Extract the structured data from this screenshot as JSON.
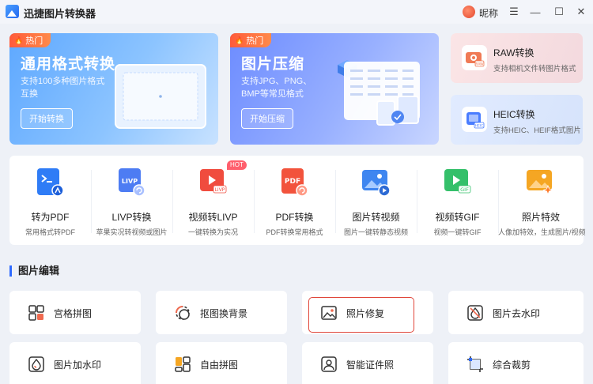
{
  "app": {
    "title": "迅捷图片转换器",
    "nickname": "昵称"
  },
  "window_controls": {
    "menu": "☰",
    "minimize": "—",
    "maximize": "☐",
    "close": "✕"
  },
  "hero_cards": [
    {
      "tag": "热门",
      "title": "通用格式转换",
      "desc": "支持100多种图片格式互换",
      "button": "开始转换",
      "accent": "#5ea8ff"
    },
    {
      "tag": "热门",
      "title": "图片压缩",
      "desc": "支持JPG、PNG、BMP等常见格式",
      "button": "开始压缩",
      "accent": "#6d8cff"
    }
  ],
  "side_cards": [
    {
      "title": "RAW转换",
      "desc": "支持相机文件转图片格式",
      "icon": "camera-raw-icon",
      "accent": "#f07a55"
    },
    {
      "title": "HEIC转换",
      "desc": "支持HEIC、HEIF格式图片",
      "icon": "heic-icon",
      "accent": "#4a7dff"
    }
  ],
  "tools": [
    {
      "name": "转为PDF",
      "desc": "常用格式转PDF",
      "icon": "to-pdf-icon",
      "color": "#2f7cf6"
    },
    {
      "name": "LIVP转换",
      "desc": "苹果实况转视频或图片",
      "icon": "livp-icon",
      "color": "#4d7cf3"
    },
    {
      "name": "视频转LIVP",
      "desc": "一键转换为实况",
      "icon": "video-to-livp-icon",
      "color": "#f04c3e",
      "badge": "HOT"
    },
    {
      "name": "PDF转换",
      "desc": "PDF转换常用格式",
      "icon": "pdf-convert-icon",
      "color": "#f2533c"
    },
    {
      "name": "图片转视频",
      "desc": "图片一键转静态视频",
      "icon": "image-to-video-icon",
      "color": "#3f86f0"
    },
    {
      "name": "视频转GIF",
      "desc": "视频一键转GIF",
      "icon": "video-to-gif-icon",
      "color": "#34c06a"
    },
    {
      "name": "照片特效",
      "desc": "人像加特效，生成图片/视频",
      "icon": "photo-effect-icon",
      "color": "#f5a623"
    }
  ],
  "section": {
    "title": "图片编辑"
  },
  "edit_buttons": [
    {
      "label": "宫格拼图",
      "icon": "grid-collage-icon"
    },
    {
      "label": "抠图换背景",
      "icon": "cutout-icon"
    },
    {
      "label": "照片修复",
      "icon": "photo-repair-icon"
    },
    {
      "label": "图片去水印",
      "icon": "remove-watermark-icon"
    },
    {
      "label": "图片加水印",
      "icon": "add-watermark-icon"
    },
    {
      "label": "自由拼图",
      "icon": "free-collage-icon"
    },
    {
      "label": "智能证件照",
      "icon": "id-photo-icon"
    },
    {
      "label": "综合裁剪",
      "icon": "crop-icon"
    }
  ]
}
